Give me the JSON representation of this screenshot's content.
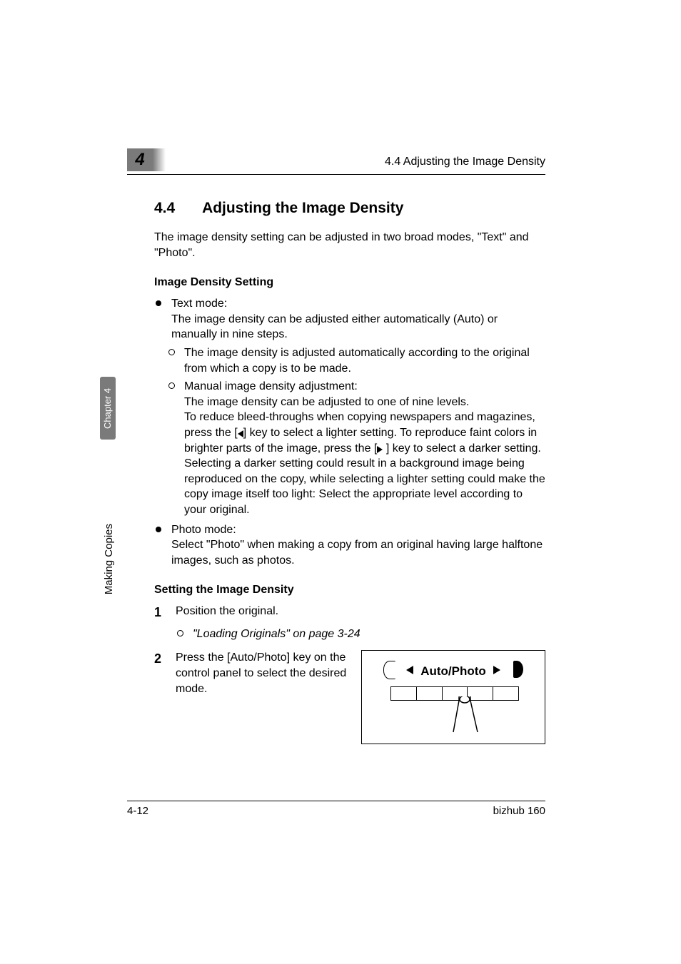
{
  "header": {
    "chapter_number": "4",
    "running_head": "4.4 Adjusting the Image Density"
  },
  "section": {
    "number": "4.4",
    "title": "Adjusting the Image Density",
    "intro": "The image density setting can be adjusted in two broad modes, \"Text\" and \"Photo\"."
  },
  "subsection1": {
    "heading": "Image Density Setting",
    "text_mode": {
      "label": "Text mode:",
      "desc": "The image density can be adjusted either automatically (Auto) or manually in nine steps.",
      "auto": "The image density is adjusted automatically according to the original from which a copy is to be made.",
      "manual_label": "Manual image density adjustment:",
      "manual_line1": "The image density can be adjusted to one of nine levels.",
      "manual_line2a": "To reduce bleed-throughs when copying newspapers and magazines, press the [",
      "manual_line2b": "] key to select a lighter setting. To reproduce faint colors in brighter parts of the image, press the [",
      "manual_line2c": "] key to select a darker setting.",
      "manual_line3": "Selecting a darker setting could result in a background image being reproduced on the copy, while selecting a lighter setting could make the copy image itself too light: Select the appropriate level according to your original."
    },
    "photo_mode": {
      "label": "Photo mode:",
      "desc": "Select \"Photo\" when making a copy from an original having large halftone images, such as photos."
    }
  },
  "subsection2": {
    "heading": "Setting the Image Density",
    "step1": {
      "num": "1",
      "text": "Position the original.",
      "ref": "\"Loading Originals\" on page 3-24"
    },
    "step2": {
      "num": "2",
      "text": "Press the [Auto/Photo] key on the control panel to select the desired mode.",
      "panel_label": "Auto/Photo"
    }
  },
  "side": {
    "tab": "Chapter 4",
    "label": "Making Copies"
  },
  "footer": {
    "page": "4-12",
    "product": "bizhub 160"
  }
}
